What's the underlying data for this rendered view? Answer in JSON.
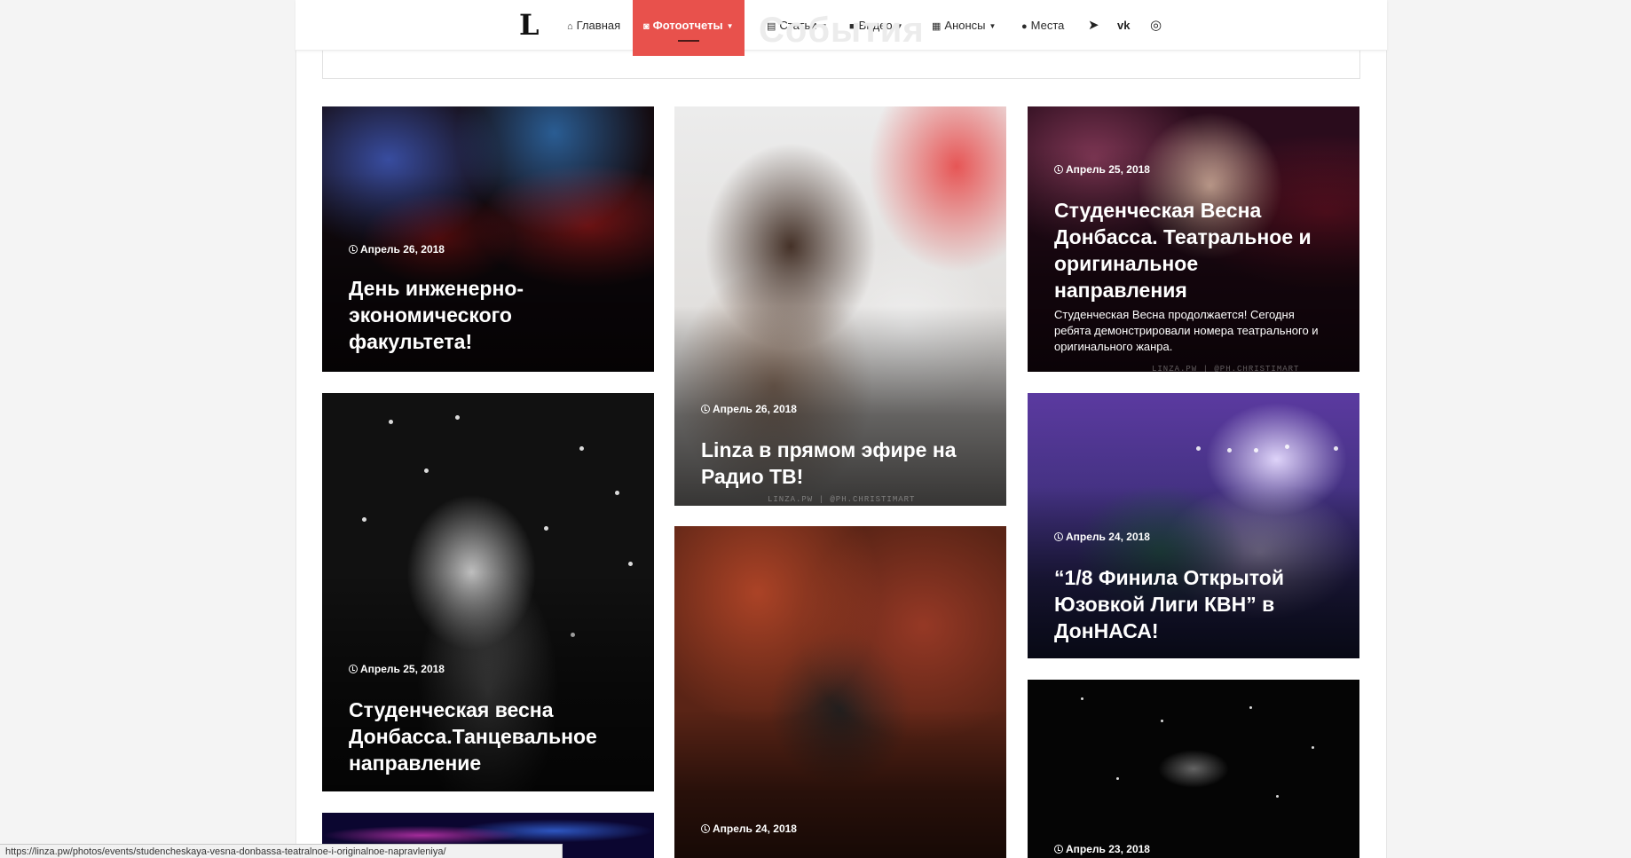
{
  "nav": {
    "logo": "L",
    "items": [
      {
        "label": "Главная",
        "icon": "home-icon",
        "glyph": "⌂",
        "has_caret": false,
        "active": false
      },
      {
        "label": "Фотоотчеты",
        "icon": "camera-icon",
        "glyph": "◙",
        "has_caret": true,
        "active": true
      },
      {
        "label": "Статьи",
        "icon": "document-icon",
        "glyph": "▤",
        "has_caret": true,
        "active": false
      },
      {
        "label": "Видео",
        "icon": "video-camera-icon",
        "glyph": "■",
        "has_caret": true,
        "active": false
      },
      {
        "label": "Анонсы",
        "icon": "calendar-icon",
        "glyph": "▦",
        "has_caret": true,
        "active": false
      },
      {
        "label": "Места",
        "icon": "map-marker-icon",
        "glyph": "●",
        "has_caret": false,
        "active": false
      }
    ],
    "social": [
      {
        "icon": "telegram-icon",
        "glyph": "➤"
      },
      {
        "icon": "vk-icon",
        "glyph": "vk"
      },
      {
        "icon": "instagram-icon",
        "glyph": "◎"
      }
    ],
    "active_color": "#e8514c"
  },
  "section_heading": "События",
  "cards": [
    {
      "date": "Апрель 26, 2018",
      "title": "День инженерно-экономического факультета!",
      "excerpt": ""
    },
    {
      "date": "Апрель 26, 2018",
      "title": "Linza в прямом эфире на Радио ТВ!",
      "excerpt": ""
    },
    {
      "date": "Апрель 25, 2018",
      "title": "Студенческая Весна Донбасса. Театральное и оригинальное направления",
      "excerpt": "Студенческая Весна продолжается! Сегодня ребята демонстрировали номера театрального и оригинального жанра."
    },
    {
      "date": "Апрель 25, 2018",
      "title": "Студенческая весна Донбасса.Танцевальное направление",
      "excerpt": ""
    },
    {
      "date": "Апрель 24, 2018",
      "title": "",
      "excerpt": ""
    },
    {
      "date": "Апрель 24, 2018",
      "title": "“1/8 Финила Открытой Юзовкой Лиги КВН” в ДонНАСА!",
      "excerpt": ""
    },
    {
      "date": "Апрель 23, 2018",
      "title": "",
      "excerpt": ""
    }
  ],
  "watermarks": {
    "linza_ph": "LINZA.PW | @PH.CHRISTIMART"
  },
  "status_url": "https://linza.pw/photos/events/studencheskaya-vesna-donbassa-teatralnoe-i-originalnoe-napravleniya/"
}
